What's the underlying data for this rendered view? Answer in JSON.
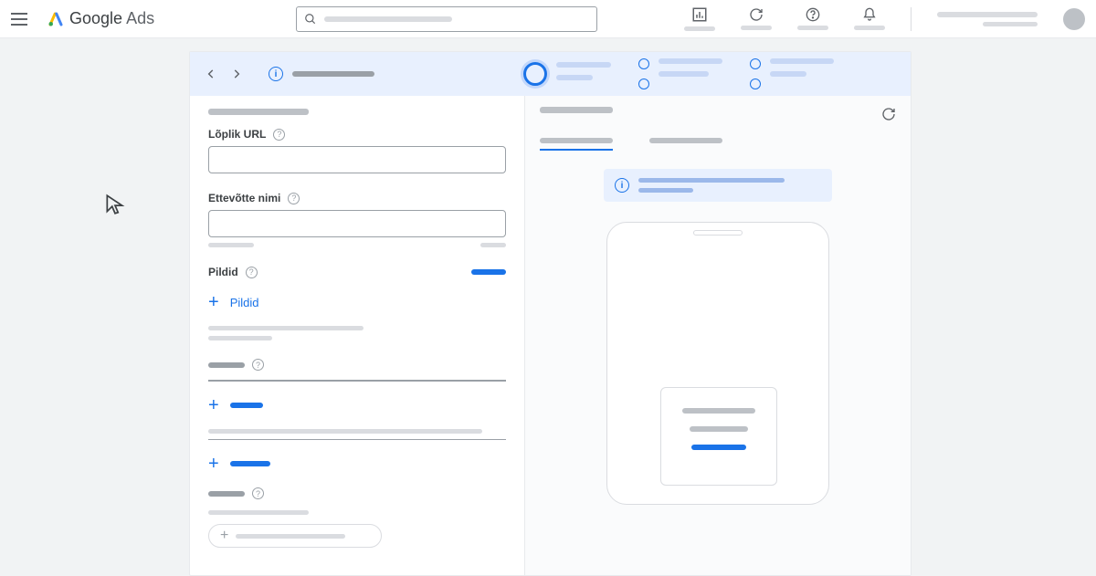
{
  "header": {
    "brand_google": "Google",
    "brand_ads": "Ads",
    "search_placeholder": ""
  },
  "form": {
    "final_url_label": "Lõplik URL",
    "business_name_label": "Ettevõtte nimi",
    "images_label": "Pildid",
    "add_images_label": "Pildid"
  },
  "colors": {
    "primary": "#1a73e8"
  }
}
